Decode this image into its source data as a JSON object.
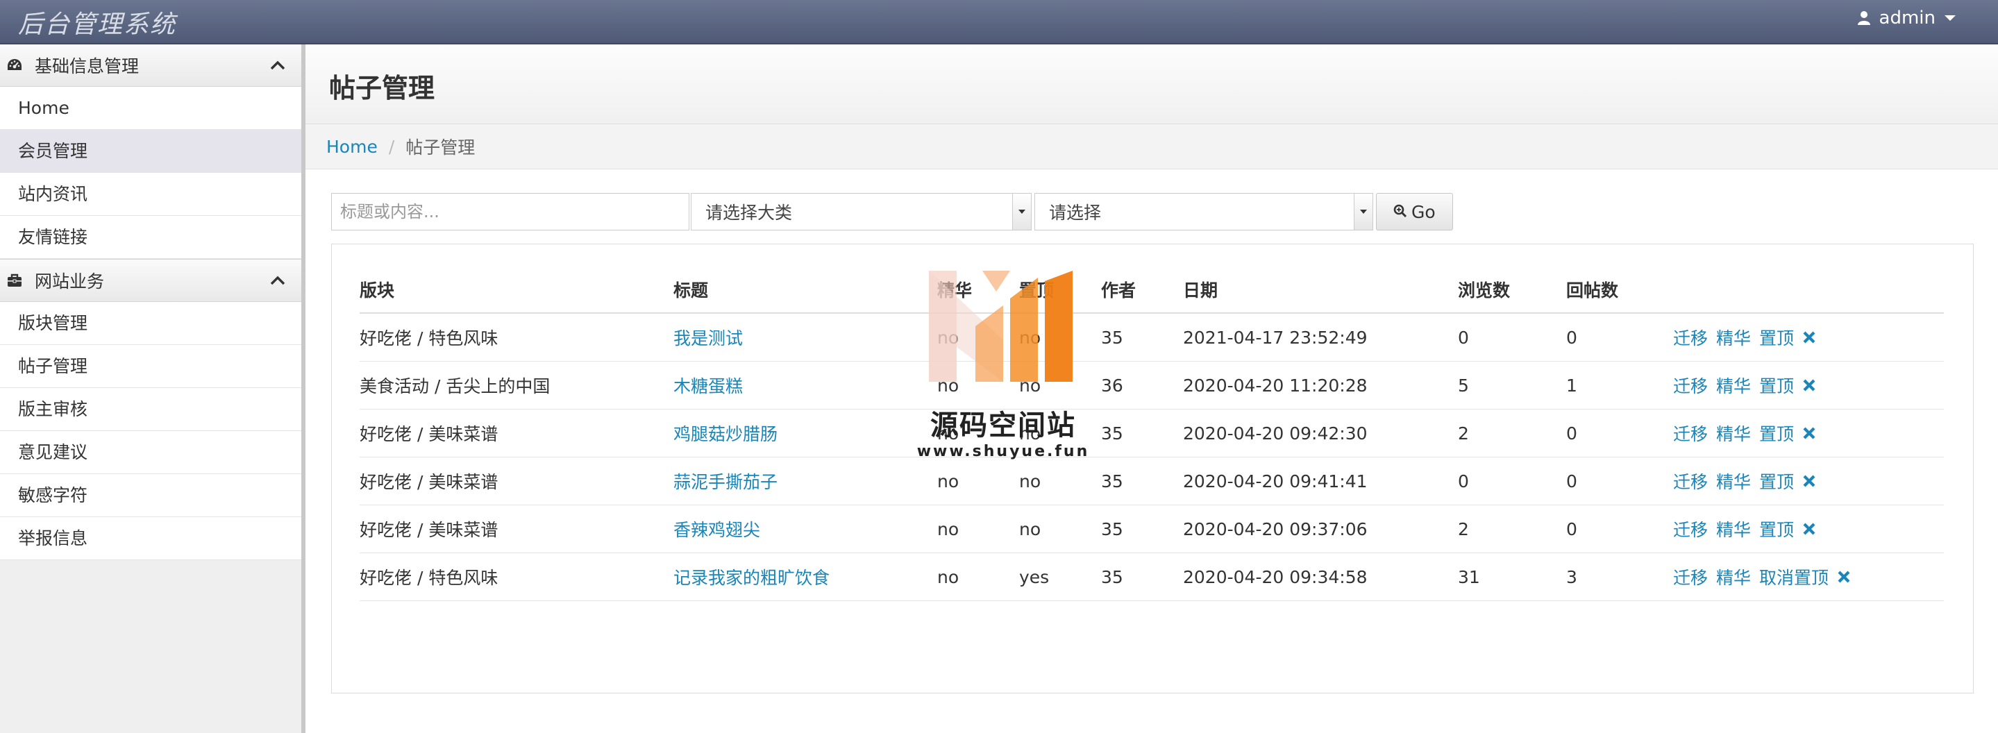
{
  "header": {
    "brand": "后台管理系统",
    "user": "admin",
    "icons": {
      "user": "user-icon",
      "caret": "caret-down-icon"
    }
  },
  "sidebar": {
    "groups": [
      {
        "label": "基础信息管理",
        "icon": "dashboard-icon",
        "items": [
          {
            "label": "Home"
          },
          {
            "label": "会员管理",
            "active": true
          },
          {
            "label": "站内资讯"
          },
          {
            "label": "友情链接"
          }
        ]
      },
      {
        "label": "网站业务",
        "icon": "briefcase-icon",
        "items": [
          {
            "label": "版块管理"
          },
          {
            "label": "帖子管理"
          },
          {
            "label": "版主审核"
          },
          {
            "label": "意见建议"
          },
          {
            "label": "敏感字符"
          },
          {
            "label": "举报信息"
          }
        ]
      }
    ]
  },
  "page": {
    "title": "帖子管理",
    "breadcrumb": {
      "home": "Home",
      "sep": "/",
      "current": "帖子管理"
    }
  },
  "filters": {
    "search_placeholder": "标题或内容...",
    "category_select": "请选择大类",
    "sub_select": "请选择",
    "go_label": "Go"
  },
  "table": {
    "headers": [
      "版块",
      "标题",
      "精华",
      "置顶",
      "作者",
      "日期",
      "浏览数",
      "回帖数"
    ],
    "rows": [
      {
        "section": "好吃佬 / 特色风味",
        "title": "我是测试",
        "featured": "no",
        "pinned": "no",
        "author": "35",
        "date": "2021-04-17 23:52:49",
        "views": "0",
        "replies": "0",
        "actions": [
          "迁移",
          "精华",
          "置顶"
        ]
      },
      {
        "section": "美食活动 / 舌尖上的中国",
        "title": "木糖蛋糕",
        "featured": "no",
        "pinned": "no",
        "author": "36",
        "date": "2020-04-20 11:20:28",
        "views": "5",
        "replies": "1",
        "actions": [
          "迁移",
          "精华",
          "置顶"
        ]
      },
      {
        "section": "好吃佬 / 美味菜谱",
        "title": "鸡腿菇炒腊肠",
        "featured": "no",
        "pinned": "no",
        "author": "35",
        "date": "2020-04-20 09:42:30",
        "views": "2",
        "replies": "0",
        "actions": [
          "迁移",
          "精华",
          "置顶"
        ]
      },
      {
        "section": "好吃佬 / 美味菜谱",
        "title": "蒜泥手撕茄子",
        "featured": "no",
        "pinned": "no",
        "author": "35",
        "date": "2020-04-20 09:41:41",
        "views": "0",
        "replies": "0",
        "actions": [
          "迁移",
          "精华",
          "置顶"
        ]
      },
      {
        "section": "好吃佬 / 美味菜谱",
        "title": "香辣鸡翅尖",
        "featured": "no",
        "pinned": "no",
        "author": "35",
        "date": "2020-04-20 09:37:06",
        "views": "2",
        "replies": "0",
        "actions": [
          "迁移",
          "精华",
          "置顶"
        ]
      },
      {
        "section": "好吃佬 / 特色风味",
        "title": "记录我家的粗旷饮食",
        "featured": "no",
        "pinned": "yes",
        "author": "35",
        "date": "2020-04-20 09:34:58",
        "views": "31",
        "replies": "3",
        "actions": [
          "迁移",
          "精华",
          "取消置顶"
        ]
      }
    ]
  },
  "watermark": {
    "text": "源码空间站",
    "url": "www.shuyue.fun"
  },
  "colors": {
    "link": "#1a85b8",
    "topbar": "#5a6580",
    "active_item": "#e5e3ec",
    "watermark_orange": "#f5902a"
  }
}
